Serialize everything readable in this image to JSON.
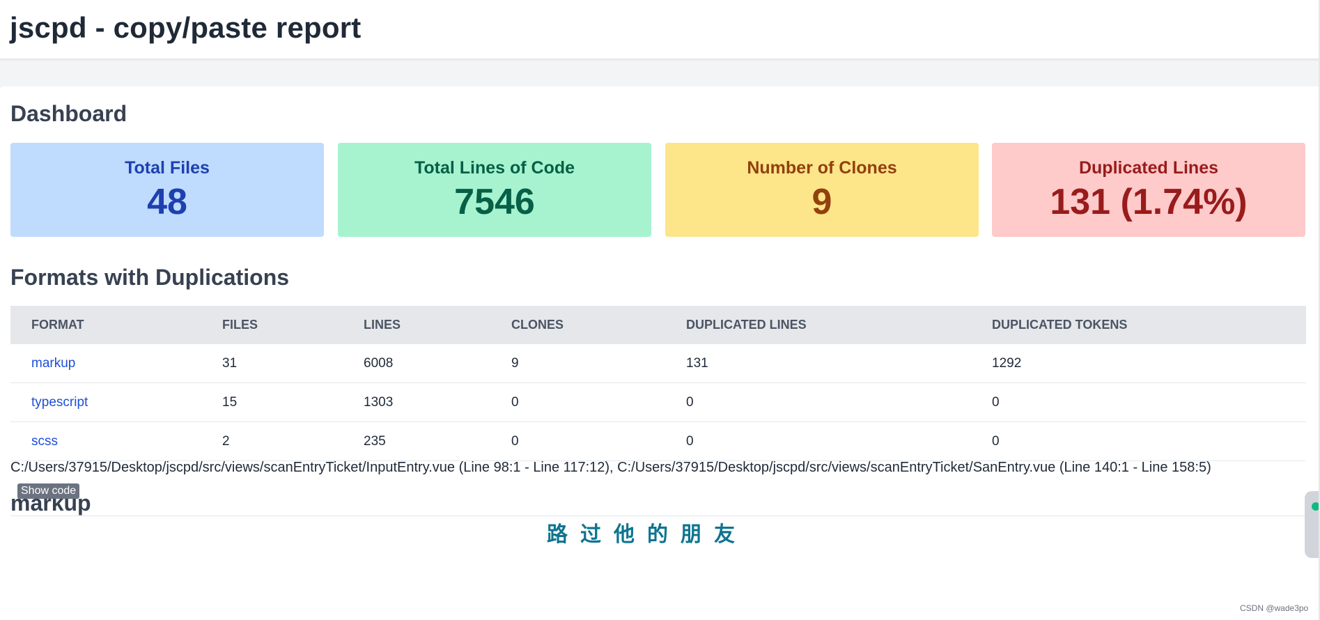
{
  "header": {
    "title": "jscpd - copy/paste report"
  },
  "dashboard": {
    "title": "Dashboard",
    "cards": [
      {
        "label": "Total Files",
        "value": "48"
      },
      {
        "label": "Total Lines of Code",
        "value": "7546"
      },
      {
        "label": "Number of Clones",
        "value": "9"
      },
      {
        "label": "Duplicated Lines",
        "value": "131 (1.74%)"
      }
    ],
    "colors": {
      "blue_bg": "#bfdbfe",
      "green_bg": "#a7f3d0",
      "yellow_bg": "#fde68a",
      "red_bg": "#fecaca"
    }
  },
  "formats": {
    "title": "Formats with Duplications",
    "columns": [
      "FORMAT",
      "FILES",
      "LINES",
      "CLONES",
      "DUPLICATED LINES",
      "DUPLICATED TOKENS"
    ],
    "rows": [
      {
        "format": "markup",
        "files": "31",
        "lines": "6008",
        "clones": "9",
        "dup_lines": "131",
        "dup_tokens": "1292"
      },
      {
        "format": "typescript",
        "files": "15",
        "lines": "1303",
        "clones": "0",
        "dup_lines": "0",
        "dup_tokens": "0"
      },
      {
        "format": "scss",
        "files": "2",
        "lines": "235",
        "clones": "0",
        "dup_lines": "0",
        "dup_tokens": "0"
      }
    ]
  },
  "markup_section": {
    "title": "markup",
    "clone_text": "C:/Users/37915/Desktop/jscpd/src/views/scanEntryTicket/InputEntry.vue (Line 98:1 - Line 117:12), C:/Users/37915/Desktop/jscpd/src/views/scanEntryTicket/SanEntry.vue (Line 140:1 - Line 158:5)",
    "show_code_label": "Show code"
  },
  "overlay": {
    "watermark_text": "路过他的朋友",
    "csdn_mark": "CSDN @wade3po"
  }
}
